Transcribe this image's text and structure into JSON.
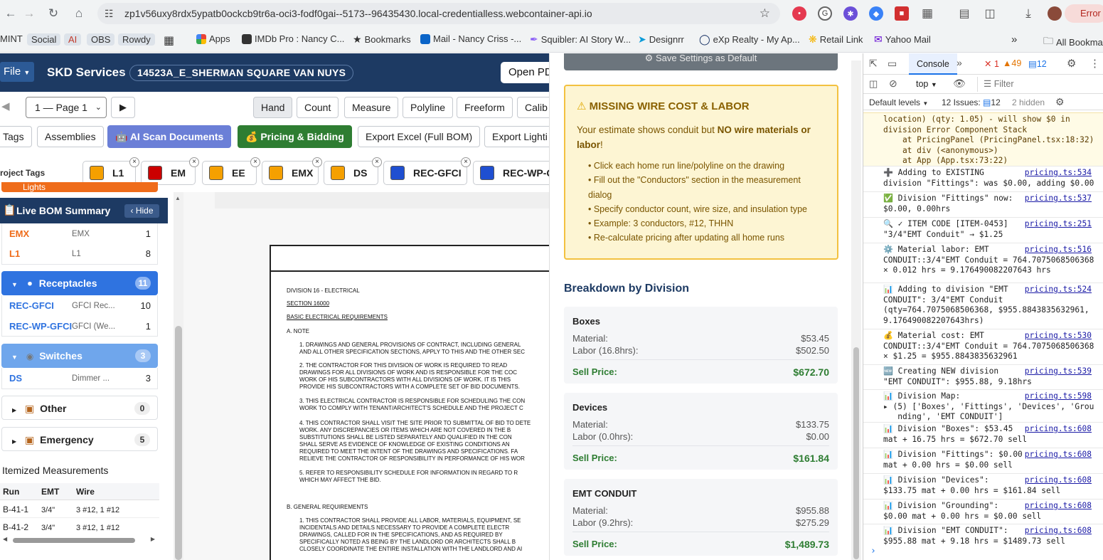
{
  "browser": {
    "url": "zp1v56uxy8rdx5ypatb0ockcb9tr6a-oci3-fodf0gai--5173--96435430.local-credentialless.webcontainer-api.io",
    "error_label": "Error"
  },
  "bookmarks": [
    {
      "label": "MINT",
      "pill": false
    },
    {
      "label": "Social",
      "pill": true
    },
    {
      "label": "AI",
      "pill": true
    },
    {
      "label": "OBS",
      "pill": true
    },
    {
      "label": "Rowdy",
      "pill": true
    },
    {
      "label": "Apps"
    },
    {
      "label": "IMDb Pro : Nancy C..."
    },
    {
      "label": "Bookmarks"
    },
    {
      "label": "Mail - Nancy Criss -..."
    },
    {
      "label": "Squibler: AI Story W..."
    },
    {
      "label": "Designrr"
    },
    {
      "label": "eXp Realty - My Ap..."
    },
    {
      "label": "Retail Link"
    },
    {
      "label": "Yahoo Mail"
    },
    {
      "label": "All Bookmarks"
    }
  ],
  "app": {
    "file_label": "File",
    "brand": "SKD Services",
    "project_name": "14523A_E_SHERMAN SQUARE VAN NUYS",
    "open_pdf": "Open PD",
    "page_select": "1 — Page 1",
    "tools": [
      "Hand",
      "Count",
      "Measure",
      "Polyline",
      "Freeform",
      "Calib"
    ],
    "actions": {
      "tags": "Tags",
      "assemblies": "Assemblies",
      "ai_scan": "AI Scan Documents",
      "pricing": "Pricing & Bidding",
      "export_excel": "Export Excel (Full BOM)",
      "export_lighting": "Export Lighti"
    },
    "project_tags_label": "roject Tags",
    "tags": [
      {
        "code": "L1",
        "color": "#f5a000"
      },
      {
        "code": "EM",
        "color": "#cc0000"
      },
      {
        "code": "EE",
        "color": "#f5a000"
      },
      {
        "code": "EMX",
        "color": "#f5a000"
      },
      {
        "code": "DS",
        "color": "#f5a000"
      },
      {
        "code": "REC-GFCI",
        "color": "#1f4fd1"
      },
      {
        "code": "REC-WP-G",
        "color": "#1f4fd1"
      }
    ]
  },
  "bom": {
    "title": "Live BOM Summary",
    "hide_label": "‹ Hide",
    "lights_partial": "Lights",
    "lights_rows": [
      {
        "code": "EMX",
        "desc": "EMX",
        "qty": "1"
      },
      {
        "code": "L1",
        "desc": "L1",
        "qty": "8"
      }
    ],
    "receptacles": {
      "label": "Receptacles",
      "count": "11"
    },
    "receptacle_rows": [
      {
        "code": "REC-GFCI",
        "desc": "GFCI Rec...",
        "qty": "10"
      },
      {
        "code": "REC-WP-GFCI",
        "desc": "GFCI (We...",
        "qty": "1"
      }
    ],
    "switches": {
      "label": "Switches",
      "count": "3"
    },
    "switch_rows": [
      {
        "code": "DS",
        "desc": "Dimmer ...",
        "qty": "3"
      }
    ],
    "other": {
      "label": "Other",
      "count": "0"
    },
    "emergency": {
      "label": "Emergency",
      "count": "5"
    },
    "itemized_title": "Itemized Measurements",
    "columns": [
      "Run",
      "EMT",
      "Wire"
    ],
    "rows": [
      {
        "run": "B-41-1",
        "emt": "3/4\"",
        "wire": "3 #12, 1 #12"
      },
      {
        "run": "B-41-2",
        "emt": "3/4\"",
        "wire": "3 #12, 1 #12"
      }
    ]
  },
  "document": {
    "lines": [
      "DIVISION 16 - ELECTRICAL",
      "SECTION 16000",
      "BASIC ELECTRICAL REQUIREMENTS",
      "A.    NOTE",
      "1.     DRAWINGS AND GENERAL PROVISIONS OF CONTRACT, INCLUDING GENERAL",
      "        AND ALL OTHER SPECIFICATION SECTIONS, APPLY TO THIS AND THE OTHER SEC",
      "2.     THE CONTRACTOR FOR THIS DIVISION OF WORK IS REQUIRED TO READ",
      "        DRAWINGS FOR ALL DIVISIONS OF WORK AND IS RESPONSIBLE FOR THE COC",
      "        WORK OF HIS SUBCONTRACTORS WITH ALL DIVISIONS OF WORK. IT IS THIS",
      "        PROVIDE HIS SUBCONTRACTORS WITH A COMPLETE SET OF BID DOCUMENTS.",
      "3.     THIS ELECTRICAL CONTRACTOR IS RESPONSIBLE FOR SCHEDULING THE CON",
      "        WORK TO COMPLY WITH TENANT/ARCHITECT'S SCHEDULE AND THE PROJECT C",
      "4.     THIS CONTRACTOR SHALL VISIT THE SITE PRIOR TO SUBMITTAL OF BID TO DETE",
      "        WORK.  ANY DISCREPANCIES OR ITEMS WHICH ARE NOT COVERED IN THE B",
      "        SUBSTITUTIONS SHALL BE LISTED SEPARATELY AND QUALIFIED IN THE CON",
      "        SHALL SERVE AS EVIDENCE OF KNOWLEDGE OF EXISTING CONDITIONS AN",
      "        REQUIRED TO MEET THE INTENT OF THE DRAWINGS AND SPECIFICATIONS.  FA",
      "        RELIEVE THE CONTRACTOR OF RESPONSIBILITY IN PERFORMANCE OF HIS WOR",
      "5.     REFER TO RESPONSIBILITY SCHEDULE FOR INFORMATION IN REGARD TO R",
      "        WHICH MAY AFFECT THE BID.",
      "B.    GENERAL REQUIREMENTS",
      "1.     THIS CONTRACTOR SHALL PROVIDE ALL LABOR, MATERIALS, EQUIPMENT, SE",
      "        INCIDENTALS AND DETAILS NECESSARY TO PROVIDE A COMPLETE ELECTR",
      "        DRAWINGS, CALLED FOR IN THE SPECIFICATIONS, AND AS REQUIRED BY",
      "        SPECIFICALLY NOTED AS BEING BY THE LANDLORD OR ARCHITECTS SHALL B",
      "        CLOSELY COORDINATE THE ENTIRE INSTALLATION WITH THE LANDLORD AND AI"
    ]
  },
  "pricing": {
    "save_default": "Save Settings as Default",
    "warning": {
      "title": "MISSING WIRE COST & LABOR",
      "intro_pre": "Your estimate shows conduit but ",
      "intro_bold": "NO wire materials or labor",
      "intro_post": "!",
      "bullets": [
        "• Click each home run line/polyline on the drawing",
        "• Fill out the \"Conductors\" section in the measurement",
        "dialog",
        "• Specify conductor count, wire size, and insulation type",
        "• Example: 3 conductors, #12, THHN",
        "• Re-calculate pricing after updating all home runs"
      ]
    },
    "breakdown_title": "Breakdown by Division",
    "material_label": "Material:",
    "sell_label": "Sell Price:",
    "divisions": [
      {
        "name": "Boxes",
        "material": "$53.45",
        "labor_label": "Labor (16.8hrs):",
        "labor": "$502.50",
        "sell": "$672.70"
      },
      {
        "name": "Devices",
        "material": "$133.75",
        "labor_label": "Labor (0.0hrs):",
        "labor": "$0.00",
        "sell": "$161.84"
      },
      {
        "name": "EMT CONDUIT",
        "material": "$955.88",
        "labor_label": "Labor (9.2hrs):",
        "labor": "$275.29",
        "sell": "$1,489.73"
      }
    ]
  },
  "devtools": {
    "tab_console": "Console",
    "errors": "1",
    "warnings": "49",
    "messages": "12",
    "context": "top",
    "filter_placeholder": "Filter",
    "default_levels": "Default levels",
    "issues": "12 Issues:",
    "issues_count": "12",
    "hidden": "2 hidden",
    "logs": [
      {
        "text": "location) (qty: 1.05) - will show $0 in\ndivision Error Component Stack\n    at PricingPanel (PricingPanel.tsx:18:32)\n    at div (<anonymous>)\n    at App (App.tsx:73:22)",
        "src": "",
        "warn": true
      },
      {
        "text": "➕ Adding to EXISTING\ndivision \"Fittings\": was $0.00, adding $0.00",
        "src": "pricing.ts:534"
      },
      {
        "text": "✅ Division \"Fittings\" now:\n$0.00, 0.00hrs",
        "src": "pricing.ts:537"
      },
      {
        "text": "🔍 ✓ ITEM CODE [ITEM-0453]\n\"3/4\"EMT Conduit\" → $1.25",
        "src": "pricing.ts:251"
      },
      {
        "text": "⚙️ Material labor: EMT\nCONDUIT::3/4\"EMT Conduit = 764.7075068506368\n× 0.012 hrs = 9.176490082207643 hrs",
        "src": "pricing.ts:516"
      },
      {
        "text": "📊 Adding to division \"EMT\nCONDUIT\": 3/4\"EMT Conduit\n(qty=764.7075068506368, $955.8843835632961,\n9.176490082207643hrs)",
        "src": "pricing.ts:524"
      },
      {
        "text": "💰 Material cost: EMT\nCONDUIT::3/4\"EMT Conduit = 764.7075068506368\n× $1.25 = $955.8843835632961",
        "src": "pricing.ts:530"
      },
      {
        "text": "🆕 Creating NEW division\n\"EMT CONDUIT\": $955.88, 9.18hrs",
        "src": "pricing.ts:539"
      },
      {
        "text": "📊 Division Map:\n▸ (5) ['Boxes', 'Fittings', 'Devices', 'Grou\n   nding', 'EMT CONDUIT']",
        "src": "pricing.ts:598"
      },
      {
        "text": "📊 Division \"Boxes\": $53.45\nmat + 16.75 hrs = $672.70 sell",
        "src": "pricing.ts:608"
      },
      {
        "text": "📊 Division \"Fittings\": $0.00\nmat + 0.00 hrs = $0.00 sell",
        "src": "pricing.ts:608"
      },
      {
        "text": "📊 Division \"Devices\":\n$133.75 mat + 0.00 hrs = $161.84 sell",
        "src": "pricing.ts:608"
      },
      {
        "text": "📊 Division \"Grounding\":\n$0.00 mat + 0.00 hrs = $0.00 sell",
        "src": "pricing.ts:608"
      },
      {
        "text": "📊 Division \"EMT CONDUIT\":\n$955.88 mat + 9.18 hrs = $1489.73 sell",
        "src": "pricing.ts:608"
      }
    ]
  }
}
